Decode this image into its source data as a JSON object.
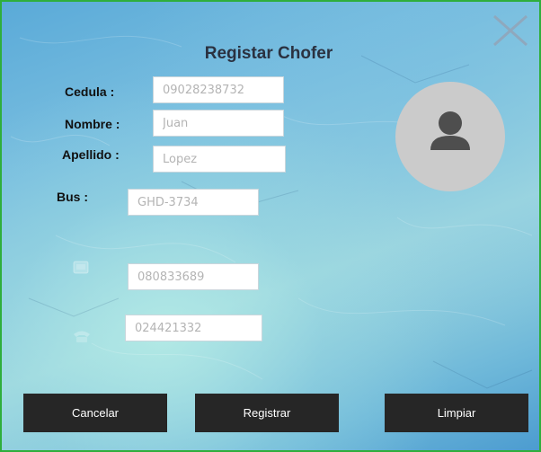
{
  "window": {
    "title": "Registar Chofer"
  },
  "form": {
    "cedula": {
      "label": "Cedula :",
      "placeholder": "09028238732"
    },
    "nombre": {
      "label": "Nombre :",
      "placeholder": "Juan"
    },
    "apellido": {
      "label": "Apellido :",
      "placeholder": "Lopez"
    },
    "bus": {
      "label": "Bus :",
      "placeholder": "GHD-3734"
    },
    "celular": {
      "icon": "mobile-phone-icon",
      "placeholder": "080833689"
    },
    "telefono": {
      "icon": "telephone-icon",
      "placeholder": "024421332"
    }
  },
  "avatar": {
    "icon": "user-icon"
  },
  "buttons": {
    "cancelar": "Cancelar",
    "registrar": "Registrar",
    "limpiar": "Limpiar"
  },
  "colors": {
    "border": "#2fae3c",
    "button_bg": "#262626",
    "button_text": "#ffffff",
    "title_text": "#2a3140",
    "avatar_bg": "#cbcbcb"
  }
}
